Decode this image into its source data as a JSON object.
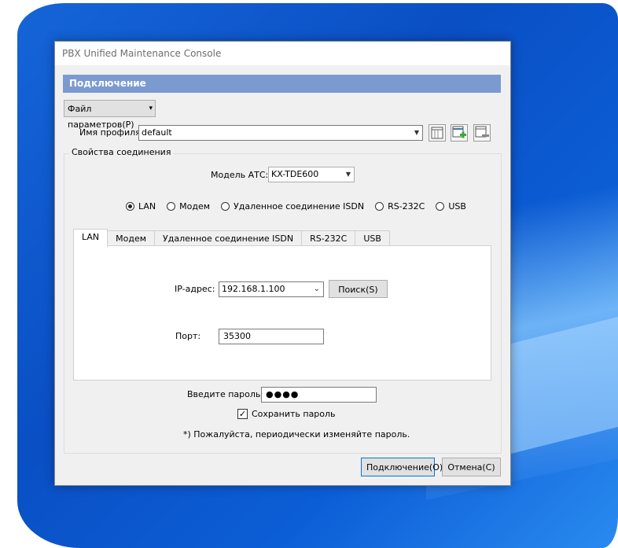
{
  "window": {
    "title": "PBX Unified Maintenance Console"
  },
  "header": {
    "title": "Подключение"
  },
  "file_button": {
    "label": "Файл параметров(P)"
  },
  "profile": {
    "label": "Имя профиля:",
    "value": "default"
  },
  "group": {
    "title": "Свойства соединения"
  },
  "pbx_model": {
    "label": "Модель АТС:",
    "value": "KX-TDE600"
  },
  "connection_types": [
    {
      "label": "LAN",
      "selected": true
    },
    {
      "label": "Модем",
      "selected": false
    },
    {
      "label": "Удаленное соединение ISDN",
      "selected": false
    },
    {
      "label": "RS-232C",
      "selected": false
    },
    {
      "label": "USB",
      "selected": false
    }
  ],
  "tabs": [
    "LAN",
    "Модем",
    "Удаленное соединение ISDN",
    "RS-232C",
    "USB"
  ],
  "lan": {
    "ip_label": "IP-адрес:",
    "ip_value": "192.168.1.100",
    "search_button": "Поиск(S)",
    "port_label": "Порт:",
    "port_value": "35300"
  },
  "password": {
    "label": "Введите пароль:",
    "value": "●●●●"
  },
  "save_password": {
    "label": "Сохранить пароль",
    "checked": true,
    "mark": "✓"
  },
  "note": "*) Пожалуйста, периодически изменяйте пароль.",
  "buttons": {
    "connect": "Подключение(O)",
    "cancel": "Отмена(C)"
  },
  "colors": {
    "header_bg": "#7b9ad0",
    "wallpaper": "#0a4fc4"
  }
}
